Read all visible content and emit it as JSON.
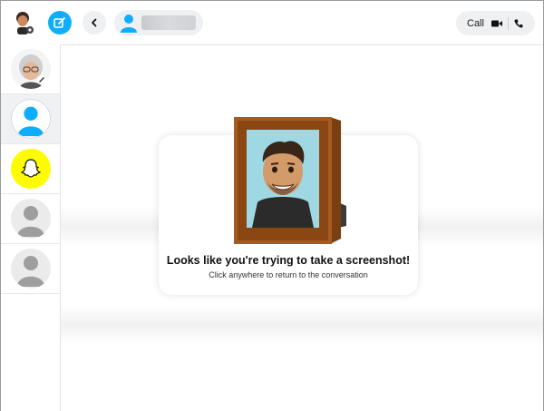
{
  "header": {
    "call_label": "Call"
  },
  "dialog": {
    "title": "Looks like you're trying to take a screenshot!",
    "subtitle": "Click anywhere to return to the conversation"
  },
  "sidebar": {
    "items": [
      {
        "kind": "bitmoji-friend",
        "active": false
      },
      {
        "kind": "default-avatar-blue",
        "active": true
      },
      {
        "kind": "snapchat-ghost",
        "active": false
      },
      {
        "kind": "default-avatar-gray",
        "active": false
      },
      {
        "kind": "default-avatar-gray",
        "active": false
      }
    ]
  },
  "colors": {
    "accent_blue": "#0fadff",
    "snap_yellow": "#fffc00",
    "pill_gray": "#eef0f2"
  }
}
